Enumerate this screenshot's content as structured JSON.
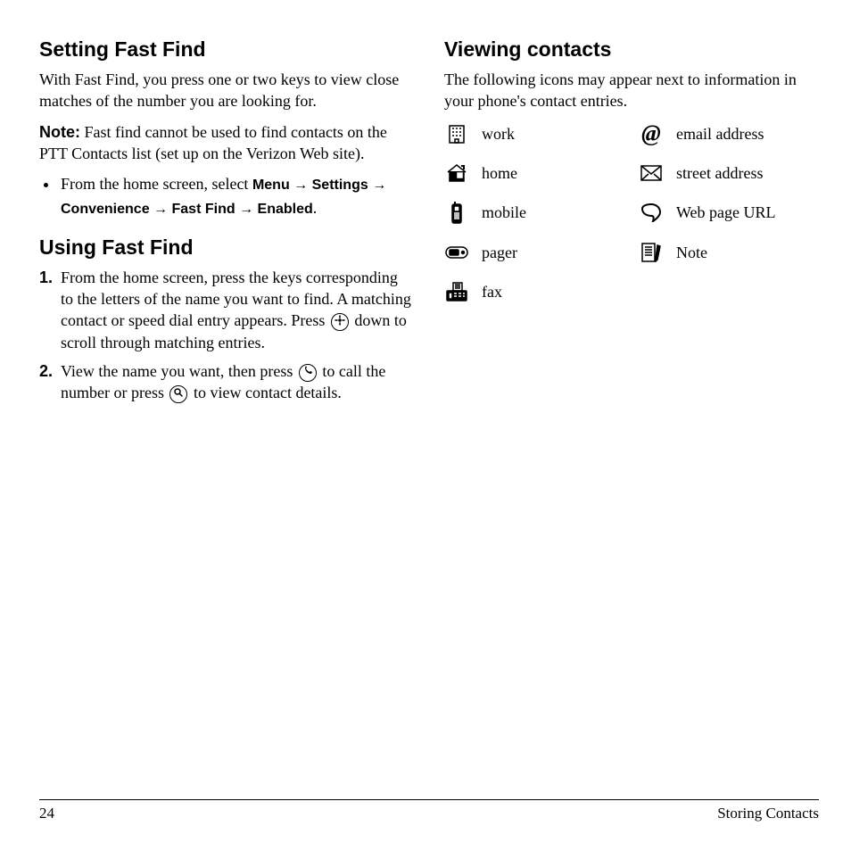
{
  "left": {
    "h1": "Setting Fast Find",
    "p1": "With Fast Find, you press one or two keys to view close matches of the number you are looking for.",
    "note_label": "Note:",
    "note_text": " Fast find cannot be used to find contacts on the PTT Contacts list (set up on the Verizon Web site).",
    "bullet_prefix": "From the home screen, select ",
    "menu_path": [
      "Menu",
      "Settings",
      "Convenience",
      "Fast Find",
      "Enabled"
    ],
    "h2": "Using Fast Find",
    "steps": [
      {
        "num": "1.",
        "pre": "From the home screen, press the keys corresponding to the letters of the name you want to find. A matching contact or speed dial entry appears. Press ",
        "mid": " down to scroll through matching entries."
      },
      {
        "num": "2.",
        "pre": "View the name you want, then press ",
        "mid": " to call the number or press ",
        "post": " to view contact details."
      }
    ]
  },
  "right": {
    "h1": "Viewing contacts",
    "p1": "The following icons may appear next to information in your phone's contact entries.",
    "icons": {
      "work": "work",
      "home": "home",
      "mobile": "mobile",
      "pager": "pager",
      "fax": "fax",
      "email": "email address",
      "street": "street address",
      "web": "Web page URL",
      "note": "Note"
    }
  },
  "footer": {
    "page": "24",
    "section": "Storing Contacts"
  }
}
